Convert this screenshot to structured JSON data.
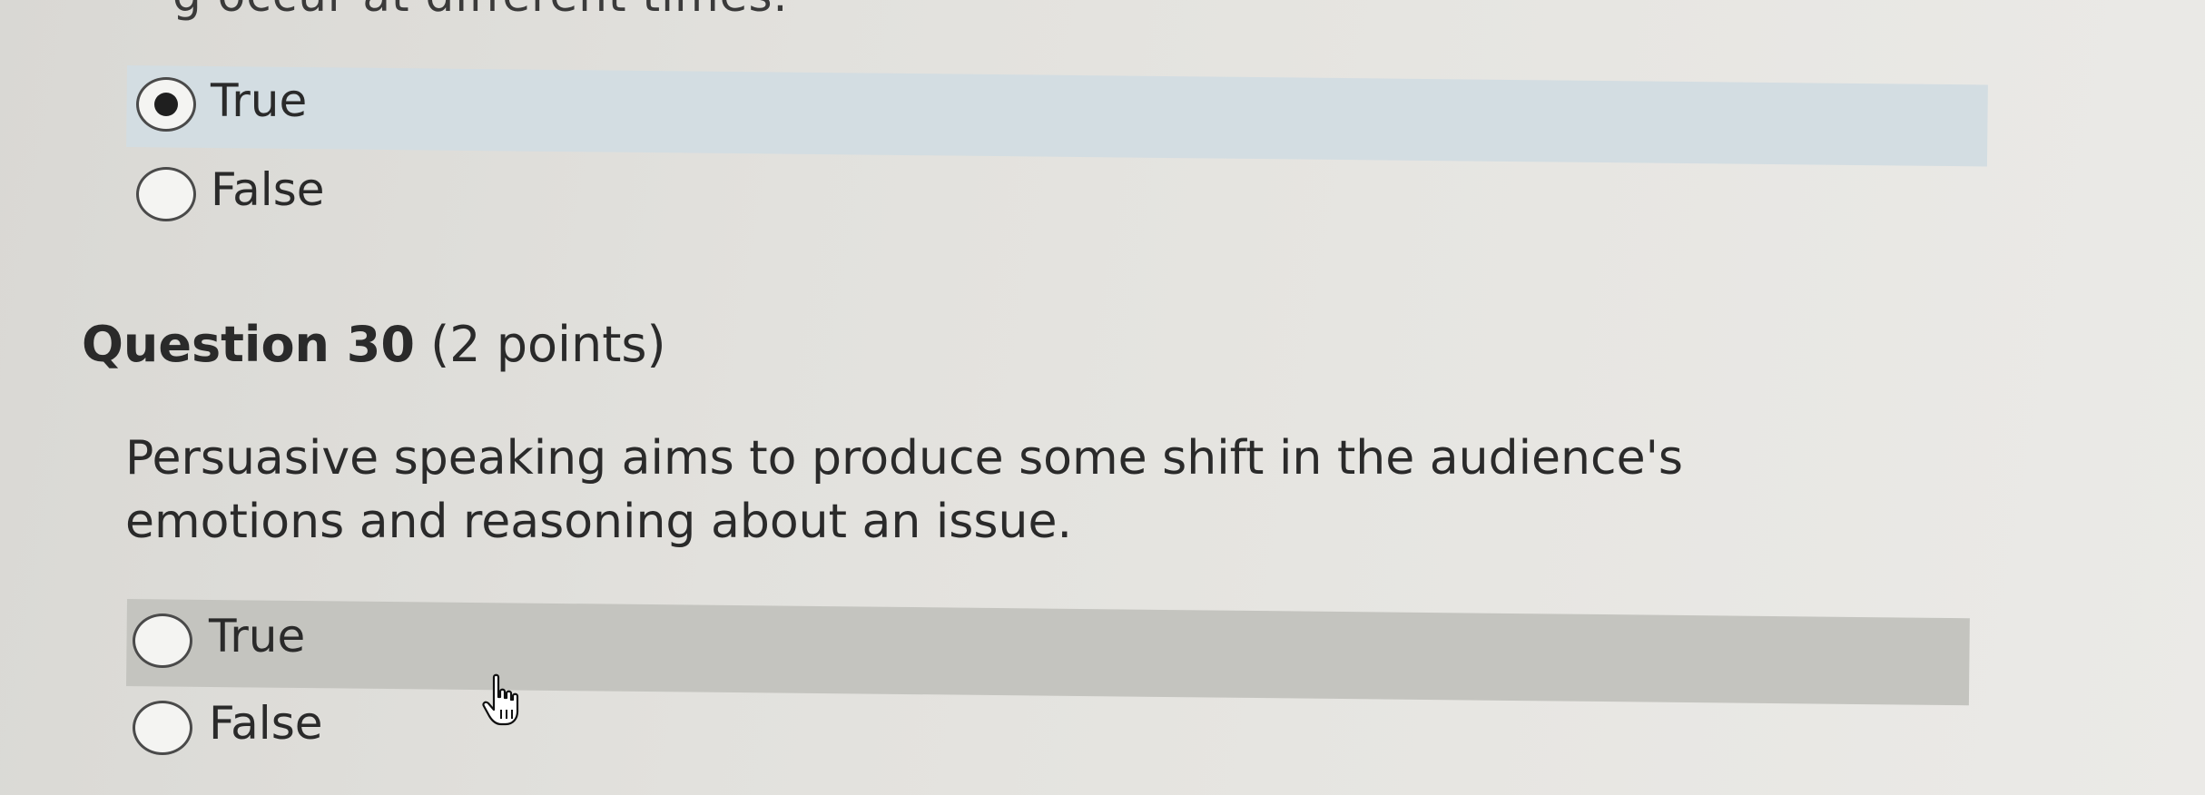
{
  "previous_question": {
    "cut_text": "g occur at different times.",
    "options": [
      {
        "label": "True",
        "selected": true
      },
      {
        "label": "False",
        "selected": false
      }
    ]
  },
  "question": {
    "number_label": "Question 30",
    "points_label": "(2 points)",
    "text": "Persuasive speaking aims to produce some shift in the audience's emotions and reasoning about an issue.",
    "options": [
      {
        "label": "True",
        "selected": false
      },
      {
        "label": "False",
        "selected": false
      }
    ]
  },
  "icons": {
    "cursor": "hand-pointer-icon"
  },
  "colors": {
    "selected_row_bg": "#d3dde2",
    "hover_row_bg": "#c4c4bf"
  }
}
